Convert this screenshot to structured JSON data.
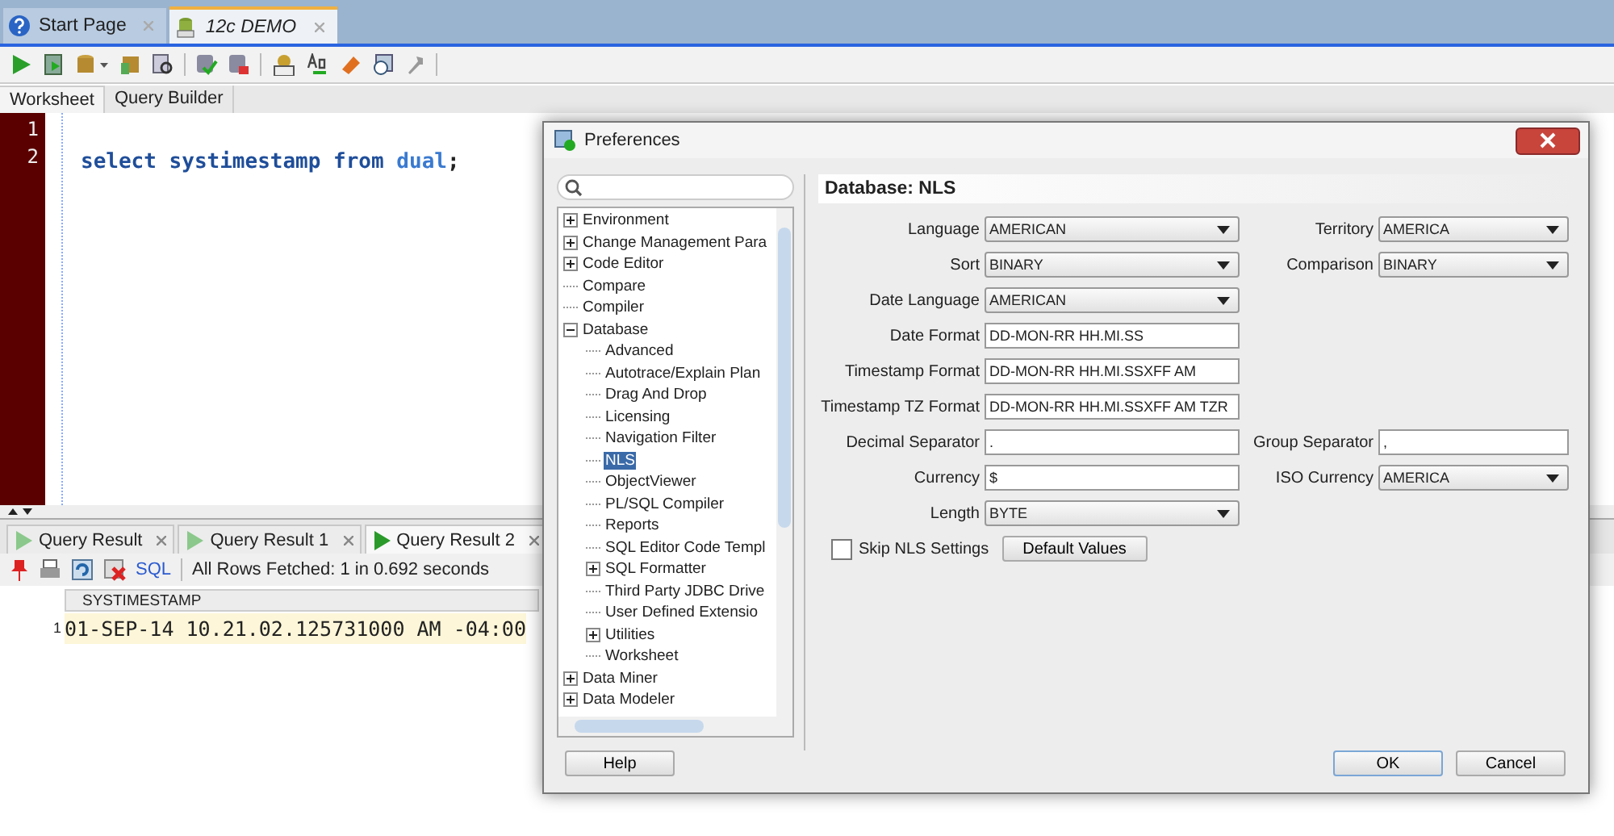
{
  "doc_tabs": [
    {
      "label": "Start Page",
      "selected": false
    },
    {
      "label": "12c DEMO",
      "selected": true
    }
  ],
  "editor_tabs": [
    {
      "label": "Worksheet",
      "selected": true
    },
    {
      "label": "Query Builder",
      "selected": false
    }
  ],
  "editor": {
    "lines": [
      {
        "number": "1"
      },
      {
        "number": "2",
        "tokens": [
          {
            "text": "select systimestamp from ",
            "kind": "keyword"
          },
          {
            "text": "dual",
            "kind": "object"
          },
          {
            "text": ";",
            "kind": "plain"
          }
        ]
      }
    ]
  },
  "result_tabs": [
    {
      "label": "Query Result",
      "selected": false
    },
    {
      "label": "Query Result 1",
      "selected": false
    },
    {
      "label": "Query Result 2",
      "selected": true
    }
  ],
  "result_toolbar": {
    "sql_link": "SQL",
    "status": "All Rows Fetched: 1 in 0.692 seconds"
  },
  "result_grid": {
    "columns": [
      "SYSTIMESTAMP"
    ],
    "rows": [
      {
        "number": "1",
        "cells": [
          "01-SEP-14 10.21.02.125731000 AM -04:00"
        ]
      }
    ]
  },
  "dialog": {
    "title": "Preferences",
    "tree": [
      {
        "label": "Environment",
        "selected": false,
        "expanded": false
      },
      {
        "label": "Change Management Para",
        "selected": false,
        "expanded": false
      },
      {
        "label": "Code Editor",
        "selected": false,
        "expanded": false
      },
      {
        "label": "Compare",
        "selected": false
      },
      {
        "label": "Compiler",
        "selected": false
      },
      {
        "label": "Database",
        "selected": false,
        "expanded": true,
        "children": [
          {
            "label": "Advanced",
            "selected": false
          },
          {
            "label": "Autotrace/Explain Plan",
            "selected": false
          },
          {
            "label": "Drag And Drop",
            "selected": false
          },
          {
            "label": "Licensing",
            "selected": false
          },
          {
            "label": "Navigation Filter",
            "selected": false
          },
          {
            "label": "NLS",
            "selected": true
          },
          {
            "label": "ObjectViewer",
            "selected": false
          },
          {
            "label": "PL/SQL Compiler",
            "selected": false
          },
          {
            "label": "Reports",
            "selected": false
          },
          {
            "label": "SQL Editor Code Templ",
            "selected": false
          },
          {
            "label": "SQL Formatter",
            "selected": false,
            "expanded": false
          },
          {
            "label": "Third Party JDBC Drive",
            "selected": false
          },
          {
            "label": "User Defined Extensio",
            "selected": false
          },
          {
            "label": "Utilities",
            "selected": false,
            "expanded": false
          },
          {
            "label": "Worksheet",
            "selected": false
          }
        ]
      },
      {
        "label": "Data Miner",
        "selected": false,
        "expanded": false
      },
      {
        "label": "Data Modeler",
        "selected": false,
        "expanded": false
      }
    ],
    "heading": "Database: NLS",
    "rows": [
      {
        "left": {
          "label": "Language",
          "kind": "dropdown",
          "value": "AMERICAN"
        },
        "right": {
          "label": "Territory",
          "kind": "dropdown",
          "value": "AMERICA"
        }
      },
      {
        "left": {
          "label": "Sort",
          "kind": "dropdown",
          "value": "BINARY"
        },
        "right": {
          "label": "Comparison",
          "kind": "dropdown",
          "value": "BINARY"
        }
      },
      {
        "left": {
          "label": "Date Language",
          "kind": "dropdown",
          "value": "AMERICAN"
        }
      },
      {
        "left": {
          "label": "Date Format",
          "kind": "text",
          "value": "DD-MON-RR HH.MI.SS"
        }
      },
      {
        "left": {
          "label": "Timestamp Format",
          "kind": "text",
          "value": "DD-MON-RR HH.MI.SSXFF AM"
        }
      },
      {
        "left": {
          "label": "Timestamp TZ Format",
          "kind": "text",
          "value": "DD-MON-RR HH.MI.SSXFF AM TZR"
        }
      },
      {
        "left": {
          "label": "Decimal Separator",
          "kind": "text",
          "value": "."
        },
        "right": {
          "label": "Group Separator",
          "kind": "text",
          "value": ","
        }
      },
      {
        "left": {
          "label": "Currency",
          "kind": "text",
          "value": "$"
        },
        "right": {
          "label": "ISO Currency",
          "kind": "dropdown",
          "value": "AMERICA"
        }
      },
      {
        "left": {
          "label": "Length",
          "kind": "dropdown",
          "value": "BYTE"
        }
      }
    ],
    "skip_checkbox": {
      "label": "Skip NLS Settings",
      "checked": false
    },
    "default_button": "Default Values",
    "help_button": "Help",
    "ok_button": "OK",
    "cancel_button": "Cancel"
  }
}
